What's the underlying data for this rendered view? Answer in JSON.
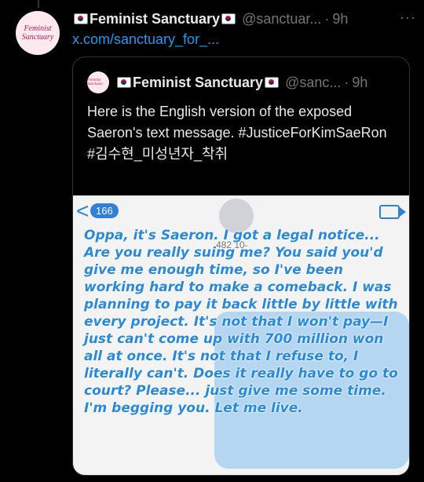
{
  "tweet": {
    "avatar_text": "Feminist Sanctuary",
    "name": "Feminist Sanctuary",
    "handle": "@sanctuar...",
    "dot": "·",
    "time": "9h",
    "more": "···",
    "link": "x.com/sanctuary_for_..."
  },
  "quote": {
    "avatar_text": "Feminist Sanctuary",
    "name": "Feminist Sanctuary",
    "handle": "@sanc...",
    "dot": "·",
    "time": "9h",
    "text": "Here is the English version of the exposed Saeron's text message. #JusticeForKimSaeRon #김수현_미성년자_착취"
  },
  "media": {
    "back_label": "<",
    "badge": "166",
    "phone_number": "482 10-",
    "message": "Oppa, it's Saeron. I got a legal notice... Are you really suing me? You said you'd give me enough time, so I've been working hard to make a comeback. I was planning to pay it back little by little with every project. It's not that I won't pay—I just can't come up with 700 million won all at once. It's not that I refuse to, I literally can't. Does it really have to go to court? Please... just give me some time. I'm begging you. Let me live."
  },
  "colors": {
    "link": "#1d9bf0",
    "secondary": "#71767b",
    "message_blue": "#2a89d8"
  }
}
